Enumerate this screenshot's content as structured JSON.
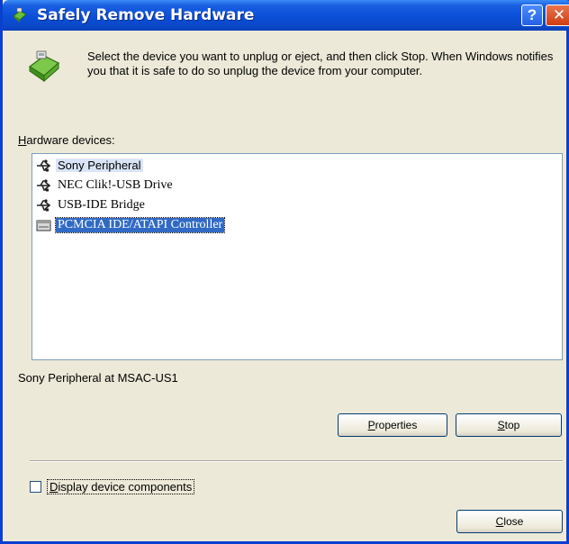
{
  "window": {
    "title": "Safely Remove Hardware",
    "help_symbol": "?",
    "close_symbol": "✕"
  },
  "intro": {
    "text": "Select the device you want to unplug or eject, and then click Stop. When Windows notifies you that it is safe to do so unplug the device from your computer.",
    "icon": "safely-remove-hardware-icon"
  },
  "hardware_list": {
    "label_accel": "H",
    "label_rest": "ardware devices:",
    "items": [
      {
        "label": "Sony Peripheral",
        "icon": "usb-icon",
        "state": "focused-light"
      },
      {
        "label": "NEC Clik!-USB Drive",
        "icon": "usb-icon",
        "state": "normal"
      },
      {
        "label": "USB-IDE Bridge",
        "icon": "usb-icon",
        "state": "normal"
      },
      {
        "label": "PCMCIA IDE/ATAPI Controller",
        "icon": "pcmcia-card-icon",
        "state": "selected"
      }
    ]
  },
  "status_text": "Sony Peripheral at MSAC-US1",
  "buttons": {
    "properties_accel": "P",
    "properties_rest": "roperties",
    "stop_accel": "S",
    "stop_rest": "top",
    "close_accel": "C",
    "close_rest": "lose"
  },
  "checkbox": {
    "label_accel": "D",
    "label_rest": "isplay device components",
    "checked": false
  },
  "colors": {
    "titlebar": "#0a4fd8",
    "selection": "#316ac5",
    "dialog_bg": "#ece9d8"
  }
}
